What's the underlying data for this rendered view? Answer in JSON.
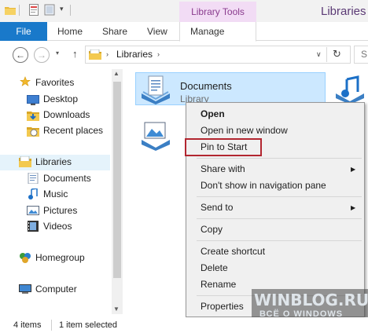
{
  "titlebar": {
    "contextual_tab_group": "Library Tools",
    "window_title": "Libraries",
    "quick_access_menu": "▾"
  },
  "ribbon": {
    "tabs": [
      {
        "label": "File"
      },
      {
        "label": "Home"
      },
      {
        "label": "Share"
      },
      {
        "label": "View"
      },
      {
        "label": "Manage"
      }
    ]
  },
  "address_bar": {
    "back": "←",
    "forward": "→",
    "recent": "▾",
    "up": "↑",
    "separator": "›",
    "path": "Libraries",
    "dropdown": "∨",
    "refresh": "↻",
    "search_placeholder": "S"
  },
  "nav_pane": {
    "favorites": "Favorites",
    "favorites_items": [
      "Desktop",
      "Downloads",
      "Recent places"
    ],
    "libraries": "Libraries",
    "libraries_items": [
      "Documents",
      "Music",
      "Pictures",
      "Videos"
    ],
    "homegroup": "Homegroup",
    "computer": "Computer"
  },
  "content": {
    "documents_title": "Documents",
    "documents_subtitle": "Library"
  },
  "context_menu": {
    "items": [
      {
        "label": "Open"
      },
      {
        "label": "Open in new window"
      },
      {
        "label": "Pin to Start"
      },
      {
        "label": "Share with"
      },
      {
        "label": "Don't show in navigation pane"
      },
      {
        "label": "Send to"
      },
      {
        "label": "Copy"
      },
      {
        "label": "Create shortcut"
      },
      {
        "label": "Delete"
      },
      {
        "label": "Rename"
      },
      {
        "label": "Properties"
      }
    ],
    "submenu_arrow": "▶",
    "highlight_color": "#b22630"
  },
  "watermark": {
    "title": "WINBLOG.RU",
    "subtitle": "ВСЁ О WINDOWS"
  },
  "status_bar": {
    "item_count": "4 items",
    "selected": "1 item selected"
  },
  "colors": {
    "file_tab": "#1979ca",
    "selection": "#cce8ff",
    "contextual_tab": "#f2dcf5"
  }
}
